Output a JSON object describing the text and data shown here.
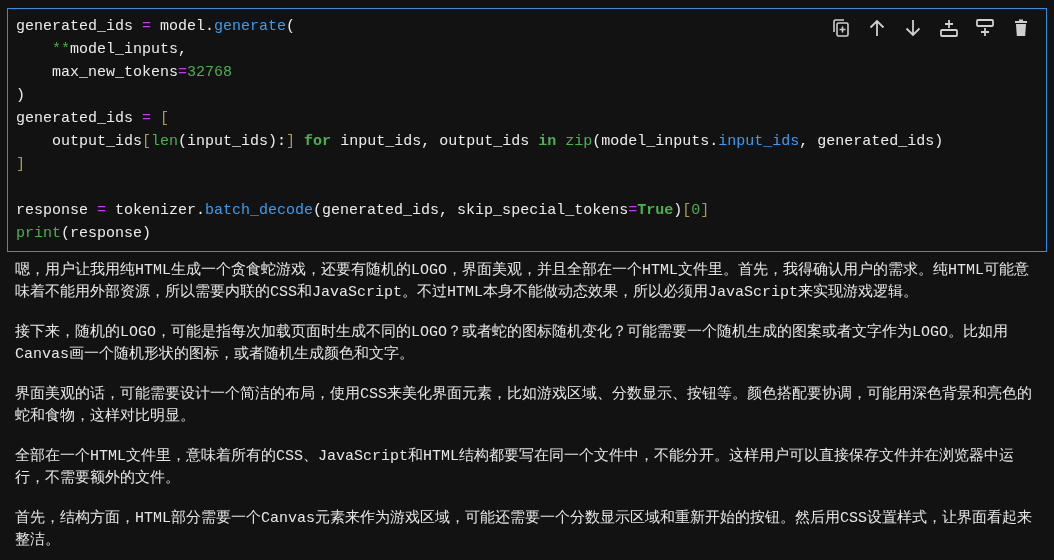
{
  "cell": {
    "code_blocks": [
      [
        [
          {
            "text": "generated_ids ",
            "kind": "plain"
          },
          {
            "text": "=",
            "kind": "op"
          },
          {
            "text": " model.",
            "kind": "plain"
          },
          {
            "text": "generate",
            "kind": "func"
          },
          {
            "text": "(",
            "kind": "plain"
          }
        ],
        [
          {
            "text": "    **",
            "kind": "num"
          },
          {
            "text": "model_inputs,",
            "kind": "plain"
          }
        ],
        [
          {
            "text": "    max_new_tokens",
            "kind": "plain"
          },
          {
            "text": "=",
            "kind": "op"
          },
          {
            "text": "32768",
            "kind": "num"
          }
        ],
        [
          {
            "text": ")",
            "kind": "plain"
          }
        ],
        [
          {
            "text": "generated_ids ",
            "kind": "plain"
          },
          {
            "text": "= ",
            "kind": "op"
          },
          {
            "text": "[",
            "kind": "bracket"
          }
        ],
        [
          {
            "text": "    output_ids",
            "kind": "plain"
          },
          {
            "text": "[",
            "kind": "bracket"
          },
          {
            "text": "len",
            "kind": "builtin"
          },
          {
            "text": "(input_ids):",
            "kind": "plain"
          },
          {
            "text": "] ",
            "kind": "bracket"
          },
          {
            "text": "for",
            "kind": "keyword"
          },
          {
            "text": " input_ids, output_ids ",
            "kind": "plain"
          },
          {
            "text": "in ",
            "kind": "keyword"
          },
          {
            "text": "zip",
            "kind": "builtin"
          },
          {
            "text": "(model_inputs.",
            "kind": "plain"
          },
          {
            "text": "input_ids",
            "kind": "func"
          },
          {
            "text": ", generated_ids)",
            "kind": "plain"
          }
        ],
        [
          {
            "text": "]",
            "kind": "bracket"
          }
        ]
      ],
      [
        [
          {
            "text": "response ",
            "kind": "plain"
          },
          {
            "text": "=",
            "kind": "op"
          },
          {
            "text": " tokenizer.",
            "kind": "plain"
          },
          {
            "text": "batch_decode",
            "kind": "func"
          },
          {
            "text": "(generated_ids, skip_special_tokens",
            "kind": "plain"
          },
          {
            "text": "=",
            "kind": "op"
          },
          {
            "text": "True",
            "kind": "keyword"
          },
          {
            "text": ")",
            "kind": "plain"
          },
          {
            "text": "[",
            "kind": "bracket"
          },
          {
            "text": "0",
            "kind": "num"
          },
          {
            "text": "]",
            "kind": "bracket"
          }
        ],
        [
          {
            "text": "print",
            "kind": "builtin"
          },
          {
            "text": "(response)",
            "kind": "plain"
          }
        ]
      ]
    ],
    "toolbar": [
      {
        "kind": "copy"
      },
      {
        "kind": "up"
      },
      {
        "kind": "down"
      },
      {
        "kind": "insert-above"
      },
      {
        "kind": "insert-below"
      },
      {
        "kind": "delete"
      }
    ]
  },
  "output": [
    "嗯，用户让我用纯HTML生成一个贪食蛇游戏，还要有随机的LOGO，界面美观，并且全部在一个HTML文件里。首先，我得确认用户的需求。纯HTML可能意味着不能用外部资源，所以需要内联的CSS和JavaScript。不过HTML本身不能做动态效果，所以必须用JavaScript来实现游戏逻辑。",
    "接下来，随机的LOGO，可能是指每次加载页面时生成不同的LOGO？或者蛇的图标随机变化？可能需要一个随机生成的图案或者文字作为LOGO。比如用Canvas画一个随机形状的图标，或者随机生成颜色和文字。",
    "界面美观的话，可能需要设计一个简洁的布局，使用CSS来美化界面元素，比如游戏区域、分数显示、按钮等。颜色搭配要协调，可能用深色背景和亮色的蛇和食物，这样对比明显。",
    "全部在一个HTML文件里，意味着所有的CSS、JavaScript和HTML结构都要写在同一个文件中，不能分开。这样用户可以直接保存文件并在浏览器中运行，不需要额外的文件。",
    "首先，结构方面，HTML部分需要一个Canvas元素来作为游戏区域，可能还需要一个分数显示区域和重新开始的按钮。然后用CSS设置样式，让界面看起来整洁。"
  ]
}
